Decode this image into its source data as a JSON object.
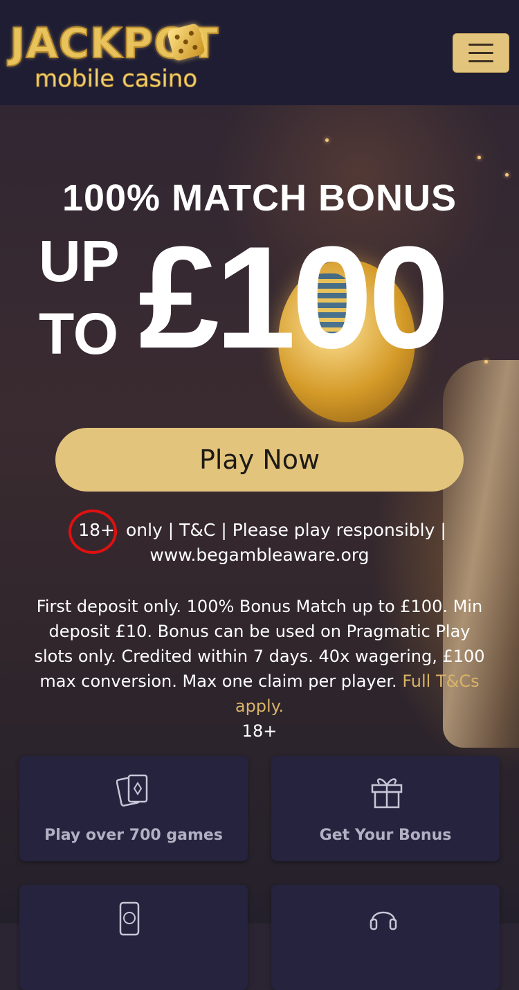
{
  "brand": {
    "logo_top": "JACKPOT",
    "logo_bottom": "mobile casino",
    "accent_color": "#e2c47c"
  },
  "header": {
    "menu_icon": "hamburger-menu-icon"
  },
  "hero": {
    "headline": "100% MATCH BONUS",
    "up": "UP",
    "to": "TO",
    "amount": "£100",
    "cta_label": "Play Now"
  },
  "responsible": {
    "age": "18+",
    "line_rest": " only | T&C | Please play responsibly |",
    "link": "www.begambleaware.org"
  },
  "terms": {
    "text": "First deposit only. 100% Bonus Match up to £100. Min deposit £10. Bonus can be used on Pragmatic Play slots only. Credited within 7 days. 40x wagering, £100 max conversion. Max one claim per player. ",
    "link_label": "Full T&Cs apply.",
    "age_note": "18+"
  },
  "features": [
    {
      "label": "Play over 700 games",
      "icon": "playing-cards-icon"
    },
    {
      "label": "Get Your Bonus",
      "icon": "gift-icon"
    },
    {
      "label": "",
      "icon": "mobile-payment-icon"
    },
    {
      "label": "",
      "icon": "headset-support-icon"
    }
  ]
}
